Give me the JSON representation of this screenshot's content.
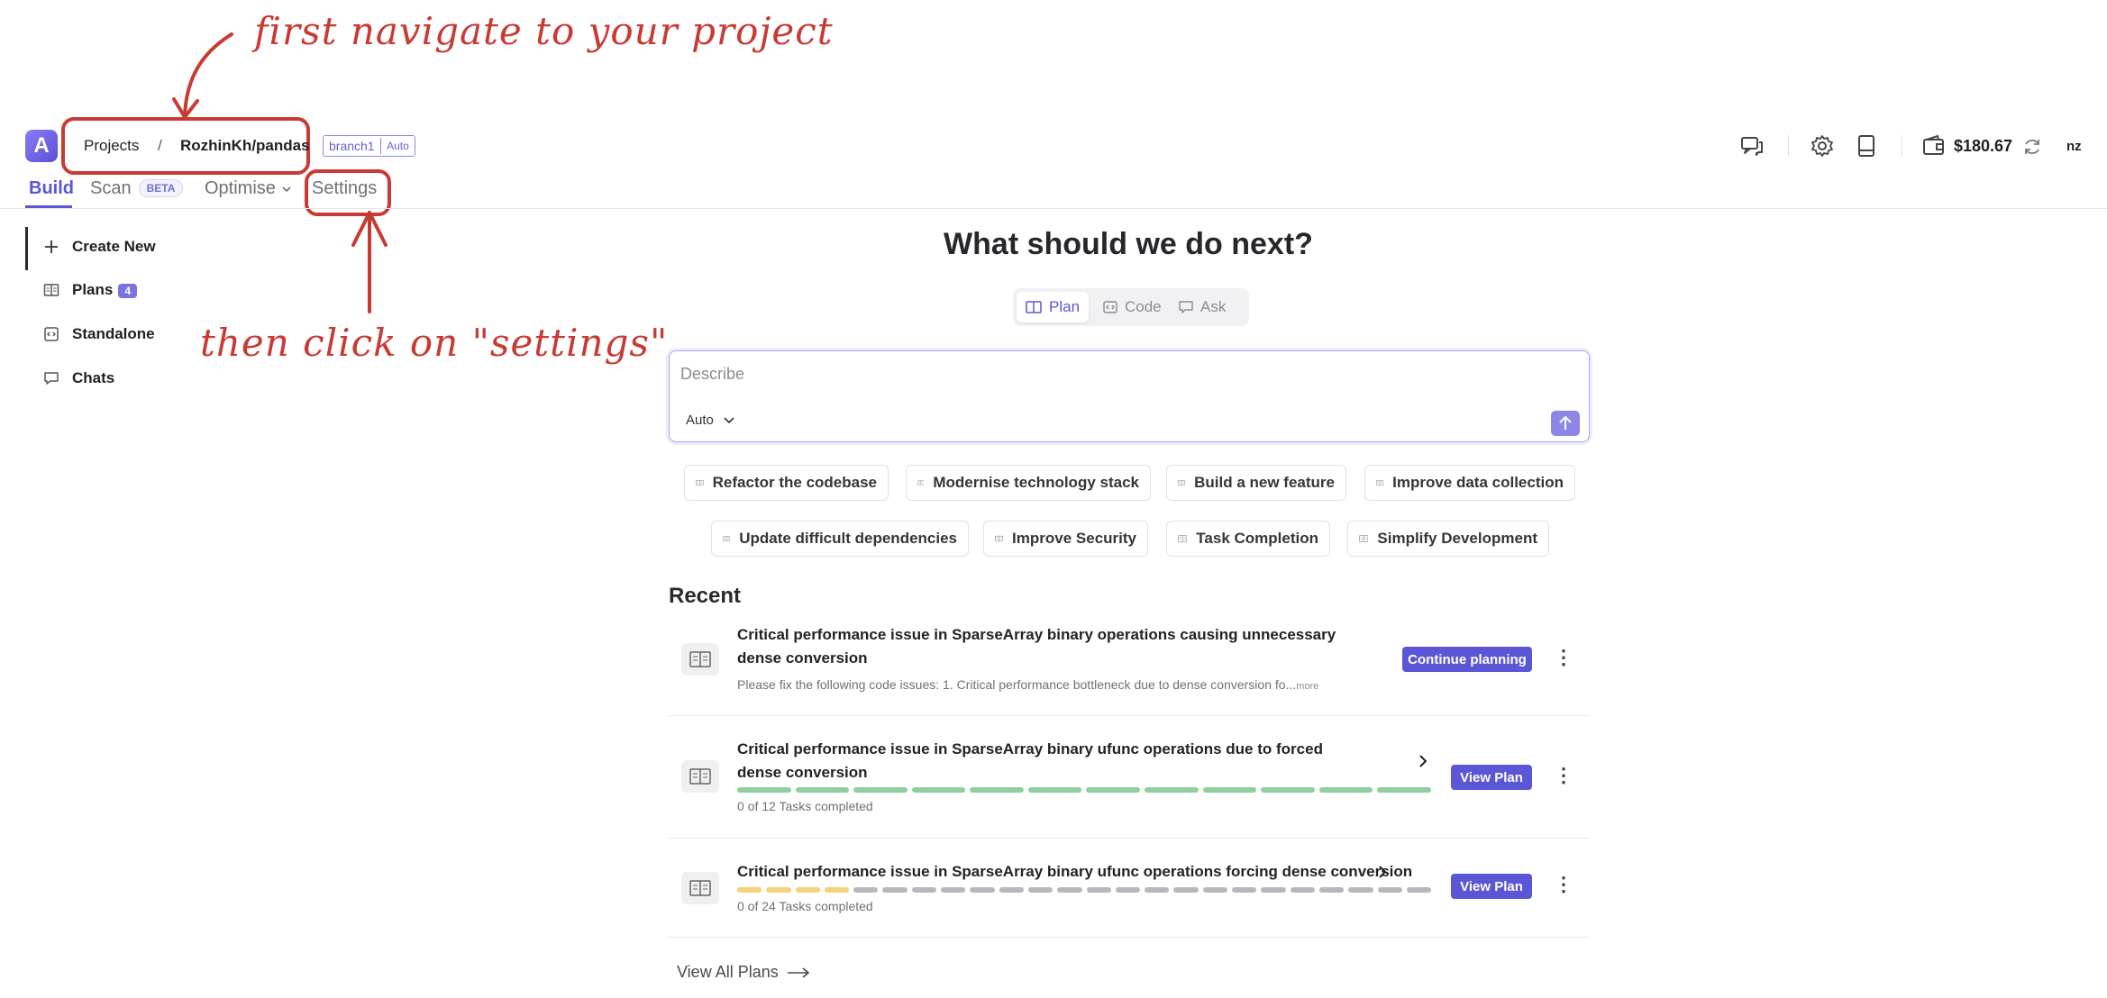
{
  "annotations": {
    "top": "first navigate to your project",
    "middle": "then click on \"settings\""
  },
  "header": {
    "logo_letter": "A",
    "breadcrumb_projects": "Projects",
    "breadcrumb_sep": "/",
    "breadcrumb_repo": "RozhinKh/pandas",
    "branch_name": "branch1",
    "branch_mode": "Auto",
    "balance": "$180.67",
    "user_initials": "nz"
  },
  "tabs": [
    {
      "label": "Build",
      "active": true
    },
    {
      "label": "Scan",
      "badge": "BETA"
    },
    {
      "label": "Optimise"
    },
    {
      "label": "Settings"
    }
  ],
  "sidebar": {
    "items": [
      {
        "label": "Create New",
        "icon": "plus-icon"
      },
      {
        "label": "Plans",
        "count": "4",
        "icon": "book-icon"
      },
      {
        "label": "Standalone",
        "icon": "code-icon"
      },
      {
        "label": "Chats",
        "icon": "chat-icon"
      }
    ]
  },
  "main": {
    "headline": "What should we do next?",
    "modes": [
      {
        "label": "Plan",
        "active": true
      },
      {
        "label": "Code"
      },
      {
        "label": "Ask"
      }
    ],
    "composer": {
      "placeholder": "Describe",
      "model": "Auto"
    },
    "suggestions": [
      "Refactor the codebase",
      "Modernise technology stack",
      "Build a new feature",
      "Improve data collection",
      "Update difficult dependencies",
      "Improve Security",
      "Task Completion",
      "Simplify Development"
    ],
    "recent_title": "Recent",
    "recent": [
      {
        "title": "Critical performance issue in SparseArray binary operations causing unnecessary dense conversion",
        "subtitle": "Please fix the following code issues: 1. Critical performance bottleneck due to dense conversion fo...",
        "more": "more",
        "action": "Continue planning"
      },
      {
        "title": "Critical performance issue in SparseArray binary ufunc operations due to forced dense conversion",
        "progress_text": "0 of 12 Tasks completed",
        "action": "View Plan",
        "tasks_total": 12,
        "segment_color": "#8fcf9f"
      },
      {
        "title": "Critical performance issue in SparseArray binary ufunc operations forcing dense conversion",
        "progress_text": "0 of 24 Tasks completed",
        "action": "View Plan",
        "tasks_total": 24,
        "highlight_segments": 4,
        "highlight_color": "#f2d27a",
        "segment_color": "#b7b8bd"
      }
    ],
    "view_all": "View All Plans"
  },
  "colors": {
    "accent": "#5b56d6",
    "annotation": "#c93a33"
  }
}
